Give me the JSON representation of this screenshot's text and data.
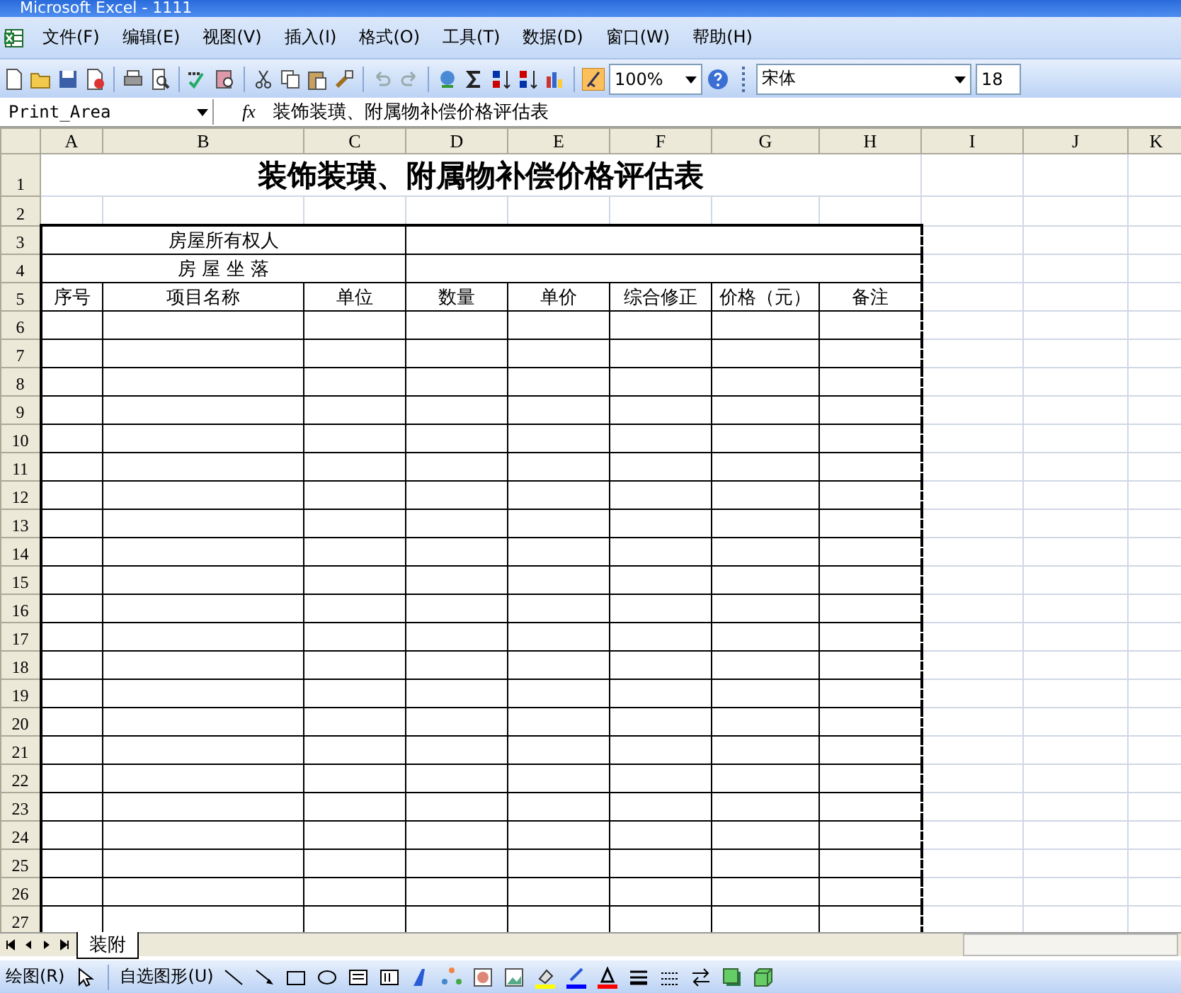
{
  "window": {
    "title": "Microsoft Excel - 1111"
  },
  "menu": [
    "文件(F)",
    "编辑(E)",
    "视图(V)",
    "插入(I)",
    "格式(O)",
    "工具(T)",
    "数据(D)",
    "窗口(W)",
    "帮助(H)"
  ],
  "toolbar": {
    "zoom": "100%",
    "font": "宋体",
    "font_size": "18"
  },
  "formula_bar": {
    "name_box": "Print_Area",
    "fx": "fx",
    "formula": "装饰装璜、附属物补偿价格评估表"
  },
  "columns": [
    "A",
    "B",
    "C",
    "D",
    "E",
    "F",
    "G",
    "H",
    "I",
    "J",
    "K"
  ],
  "row_headers": [
    "1",
    "2",
    "3",
    "4",
    "5",
    "6",
    "7",
    "8",
    "9",
    "10",
    "11",
    "12",
    "13",
    "14",
    "15",
    "16",
    "17",
    "18",
    "19",
    "20",
    "21",
    "22",
    "23",
    "24",
    "25",
    "26",
    "27"
  ],
  "sheet": {
    "title": "装饰装璜、附属物补偿价格评估表",
    "owner_label": "房屋所有权人",
    "location_label": "房 屋 坐 落",
    "header_cells": [
      "序号",
      "项目名称",
      "单位",
      "数量",
      "单价",
      "综合修正",
      "价格（元）",
      "备注"
    ]
  },
  "sheet_tabs": [
    {
      "label": "装附",
      "selected": true
    }
  ],
  "drawing_toolbar": {
    "draw": "绘图(R)",
    "autoshapes": "自选图形(U)"
  }
}
